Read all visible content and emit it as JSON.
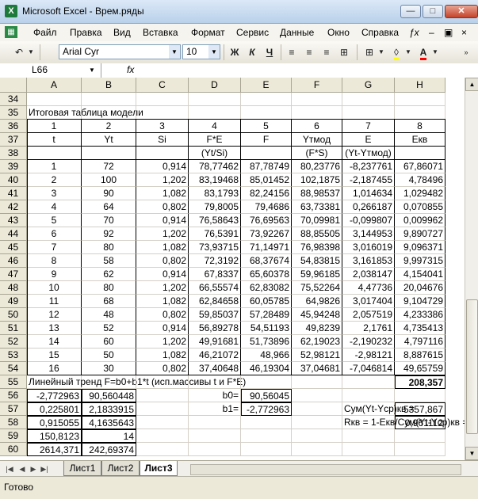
{
  "window": {
    "title": "Microsoft Excel - Врем.ряды",
    "app_icon": "X"
  },
  "menu": [
    "Файл",
    "Правка",
    "Вид",
    "Вставка",
    "Формат",
    "Сервис",
    "Данные",
    "Окно",
    "Справка"
  ],
  "toolbar": {
    "font": "Arial Cyr",
    "size": "10",
    "bold": "Ж",
    "italic": "К",
    "underline": "Ч",
    "font_color_label": "A"
  },
  "formula_bar": {
    "name_box": "L66",
    "fx": "fx",
    "formula": ""
  },
  "columns": [
    "A",
    "B",
    "C",
    "D",
    "E",
    "F",
    "G",
    "H"
  ],
  "rows": [
    {
      "n": "34",
      "cells": [
        "",
        "",
        "",
        "",
        "",
        "",
        "",
        ""
      ]
    },
    {
      "n": "35",
      "cells": [
        "Итоговая таблица модели",
        "",
        "",
        "",
        "",
        "",
        "",
        ""
      ]
    },
    {
      "n": "36",
      "cells": [
        "1",
        "2",
        "3",
        "4",
        "5",
        "6",
        "7",
        "8"
      ]
    },
    {
      "n": "37",
      "cells": [
        "t",
        "Yt",
        "Si",
        "F*E",
        "F",
        "Yтмод",
        "E",
        "Екв"
      ]
    },
    {
      "n": "38",
      "cells": [
        "",
        "",
        "",
        "(Yt/Si)",
        "",
        "(F*S)",
        "(Yt-Yтмод)",
        ""
      ]
    },
    {
      "n": "39",
      "cells": [
        "1",
        "72",
        "0,914",
        "78,77462",
        "87,78749",
        "80,23776",
        "-8,237761",
        "67,86071"
      ]
    },
    {
      "n": "40",
      "cells": [
        "2",
        "100",
        "1,202",
        "83,19468",
        "85,01452",
        "102,1875",
        "-2,187455",
        "4,78496"
      ]
    },
    {
      "n": "41",
      "cells": [
        "3",
        "90",
        "1,082",
        "83,1793",
        "82,24156",
        "88,98537",
        "1,014634",
        "1,029482"
      ]
    },
    {
      "n": "42",
      "cells": [
        "4",
        "64",
        "0,802",
        "79,8005",
        "79,4686",
        "63,73381",
        "0,266187",
        "0,070855"
      ]
    },
    {
      "n": "43",
      "cells": [
        "5",
        "70",
        "0,914",
        "76,58643",
        "76,69563",
        "70,09981",
        "-0,099807",
        "0,009962"
      ]
    },
    {
      "n": "44",
      "cells": [
        "6",
        "92",
        "1,202",
        "76,5391",
        "73,92267",
        "88,85505",
        "3,144953",
        "9,890727"
      ]
    },
    {
      "n": "45",
      "cells": [
        "7",
        "80",
        "1,082",
        "73,93715",
        "71,14971",
        "76,98398",
        "3,016019",
        "9,096371"
      ]
    },
    {
      "n": "46",
      "cells": [
        "8",
        "58",
        "0,802",
        "72,3192",
        "68,37674",
        "54,83815",
        "3,161853",
        "9,997315"
      ]
    },
    {
      "n": "47",
      "cells": [
        "9",
        "62",
        "0,914",
        "67,8337",
        "65,60378",
        "59,96185",
        "2,038147",
        "4,154041"
      ]
    },
    {
      "n": "48",
      "cells": [
        "10",
        "80",
        "1,202",
        "66,55574",
        "62,83082",
        "75,52264",
        "4,47736",
        "20,04676"
      ]
    },
    {
      "n": "49",
      "cells": [
        "11",
        "68",
        "1,082",
        "62,84658",
        "60,05785",
        "64,9826",
        "3,017404",
        "9,104729"
      ]
    },
    {
      "n": "50",
      "cells": [
        "12",
        "48",
        "0,802",
        "59,85037",
        "57,28489",
        "45,94248",
        "2,057519",
        "4,233386"
      ]
    },
    {
      "n": "51",
      "cells": [
        "13",
        "52",
        "0,914",
        "56,89278",
        "54,51193",
        "49,8239",
        "2,1761",
        "4,735413"
      ]
    },
    {
      "n": "52",
      "cells": [
        "14",
        "60",
        "1,202",
        "49,91681",
        "51,73896",
        "62,19023",
        "-2,190232",
        "4,797116"
      ]
    },
    {
      "n": "53",
      "cells": [
        "15",
        "50",
        "1,082",
        "46,21072",
        "48,966",
        "52,98121",
        "-2,98121",
        "8,887615"
      ]
    },
    {
      "n": "54",
      "cells": [
        "16",
        "30",
        "0,802",
        "37,40648",
        "46,19304",
        "37,04681",
        "-7,046814",
        "49,65759"
      ]
    },
    {
      "n": "55",
      "cells": [
        "Линейный тренд F=b0+b1*t (исп.массивы t и F*E)",
        "",
        "",
        "",
        "",
        "",
        "",
        "208,357"
      ]
    },
    {
      "n": "56",
      "cells": [
        "-2,772963",
        "90,560448",
        "",
        "b0=",
        "90,56045",
        "",
        "",
        ""
      ]
    },
    {
      "n": "57",
      "cells": [
        "0,225801",
        "2,1833915",
        "",
        "b1=",
        "-2,772963",
        "",
        "Сум(Yt-Yср)кв  =",
        "5357,867"
      ]
    },
    {
      "n": "58",
      "cells": [
        "0,915055",
        "4,1635643",
        "",
        "",
        "",
        "",
        "Rкв = 1-Екв/Сум(Yt-Yср)кв =",
        "0,961112"
      ]
    },
    {
      "n": "59",
      "cells": [
        "150,8123",
        "14",
        "",
        "",
        "",
        "",
        "",
        ""
      ]
    },
    {
      "n": "60",
      "cells": [
        "2614,371",
        "242,69374",
        "",
        "",
        "",
        "",
        "",
        ""
      ]
    }
  ],
  "sheets": [
    "Лист1",
    "Лист2",
    "Лист3"
  ],
  "active_sheet": "Лист3",
  "status": "Готово"
}
